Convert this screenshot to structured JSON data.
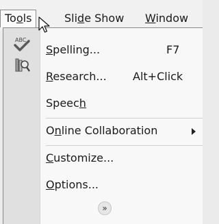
{
  "menubar": {
    "items": [
      {
        "pre": "To",
        "key": "o",
        "post": "ls"
      },
      {
        "pre": "Sli",
        "key": "d",
        "post": "e Show"
      },
      {
        "pre": "",
        "key": "W",
        "post": "indow"
      }
    ]
  },
  "menu": {
    "items": [
      {
        "pre": "",
        "key": "S",
        "post": "pelling...",
        "shortcut": "F7",
        "icon": "spelling-abc-check-icon"
      },
      {
        "pre": "",
        "key": "R",
        "post": "esearch...",
        "shortcut": "Alt+Click",
        "icon": "research-books-icon"
      },
      {
        "pre": "Speec",
        "key": "h",
        "post": ""
      },
      {
        "pre": "O",
        "key": "n",
        "post": "line Collaboration",
        "submenu": true
      },
      {
        "pre": "",
        "key": "C",
        "post": "ustomize..."
      },
      {
        "pre": "",
        "key": "O",
        "post": "ptions..."
      }
    ],
    "expand_glyph": "»"
  },
  "icons": {
    "cursor": "mouse-pointer-icon",
    "submenu": "submenu-arrow-icon",
    "expand": "expand-menu-icon"
  }
}
